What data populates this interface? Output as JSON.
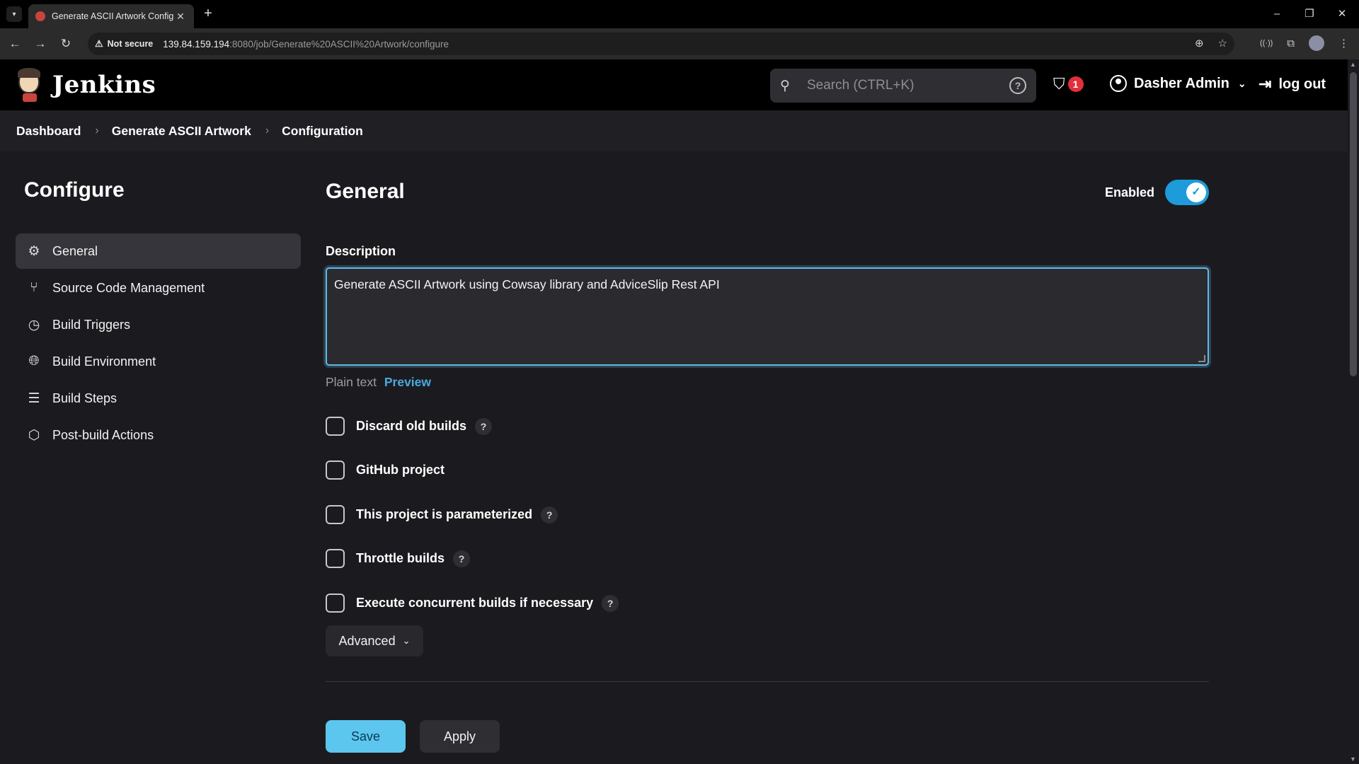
{
  "browser": {
    "tab_title": "Generate ASCII Artwork Config",
    "not_secure": "Not secure",
    "url_host": "139.84.159.194",
    "url_rest": ":8080/job/Generate%20ASCII%20Artwork/configure"
  },
  "header": {
    "logo_text": "Jenkins",
    "search_placeholder": "Search (CTRL+K)",
    "security_count": "1",
    "user_name": "Dasher Admin",
    "logout_label": "log out"
  },
  "breadcrumb": [
    "Dashboard",
    "Generate ASCII Artwork",
    "Configuration"
  ],
  "sidebar": {
    "title": "Configure",
    "items": [
      {
        "label": "General",
        "icon": "gear-icon"
      },
      {
        "label": "Source Code Management",
        "icon": "branch-icon"
      },
      {
        "label": "Build Triggers",
        "icon": "clock-icon"
      },
      {
        "label": "Build Environment",
        "icon": "globe-icon"
      },
      {
        "label": "Build Steps",
        "icon": "list-icon"
      },
      {
        "label": "Post-build Actions",
        "icon": "cube-icon"
      }
    ]
  },
  "main": {
    "section_title": "General",
    "enabled_label": "Enabled",
    "enabled": true,
    "description_label": "Description",
    "description_value": "Generate ASCII Artwork using Cowsay library and AdviceSlip Rest API",
    "plain_text": "Plain text",
    "preview": "Preview",
    "options": [
      {
        "label": "Discard old builds",
        "help": true,
        "checked": false
      },
      {
        "label": "GitHub project",
        "help": false,
        "checked": false
      },
      {
        "label": "This project is parameterized",
        "help": true,
        "checked": false
      },
      {
        "label": "Throttle builds",
        "help": true,
        "checked": false
      },
      {
        "label": "Execute concurrent builds if necessary",
        "help": true,
        "checked": false
      }
    ],
    "help_mark": "?",
    "advanced_label": "Advanced",
    "save_label": "Save",
    "apply_label": "Apply"
  },
  "colors": {
    "accent": "#1d9bdb",
    "save_button": "#5cc6ef",
    "badge": "#e2303b"
  }
}
